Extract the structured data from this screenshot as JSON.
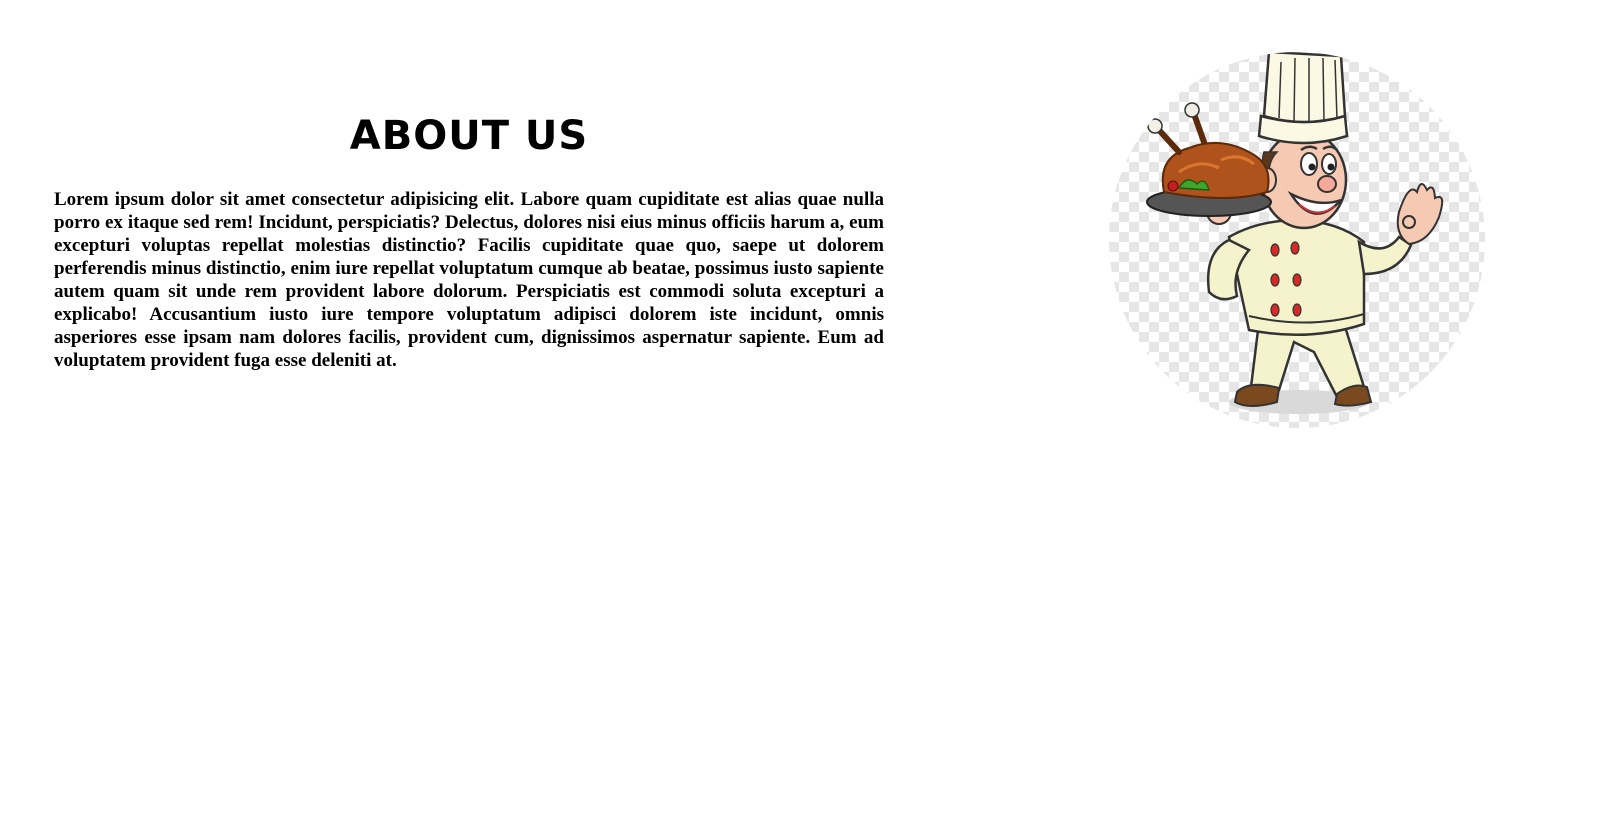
{
  "about": {
    "title": "ABOUT US",
    "paragraph": "Lorem ipsum dolor sit amet consectetur adipisicing elit. Labore quam cupiditate est alias quae nulla porro ex itaque sed rem! Incidunt, perspiciatis? Delectus, dolores nisi eius minus officiis harum a, eum excepturi voluptas repellat molestias distinctio? Facilis cupiditate quae quo, saepe ut dolorem perferendis minus distinctio, enim iure repellat voluptatum cumque ab beatae, possimus iusto sapiente autem quam sit unde rem provident labore dolorum. Perspiciatis est commodi soluta excepturi a explicabo! Accusantium iusto iure tempore voluptatum adipisci dolorem iste incidunt, omnis asperiores esse ipsam nam dolores facilis, provident cum, dignissimos aspernatur sapiente. Eum ad voluptatem provident fuga esse deleniti at."
  },
  "image": {
    "subject": "chef-illustration",
    "colors": {
      "hat": "#fbf8e3",
      "uniform": "#f5f3cc",
      "buttons": "#d42a2a",
      "skin": "#f6c9b3",
      "turkey": "#b0521c",
      "tray": "#555555",
      "shoes": "#7a4a1e"
    }
  }
}
